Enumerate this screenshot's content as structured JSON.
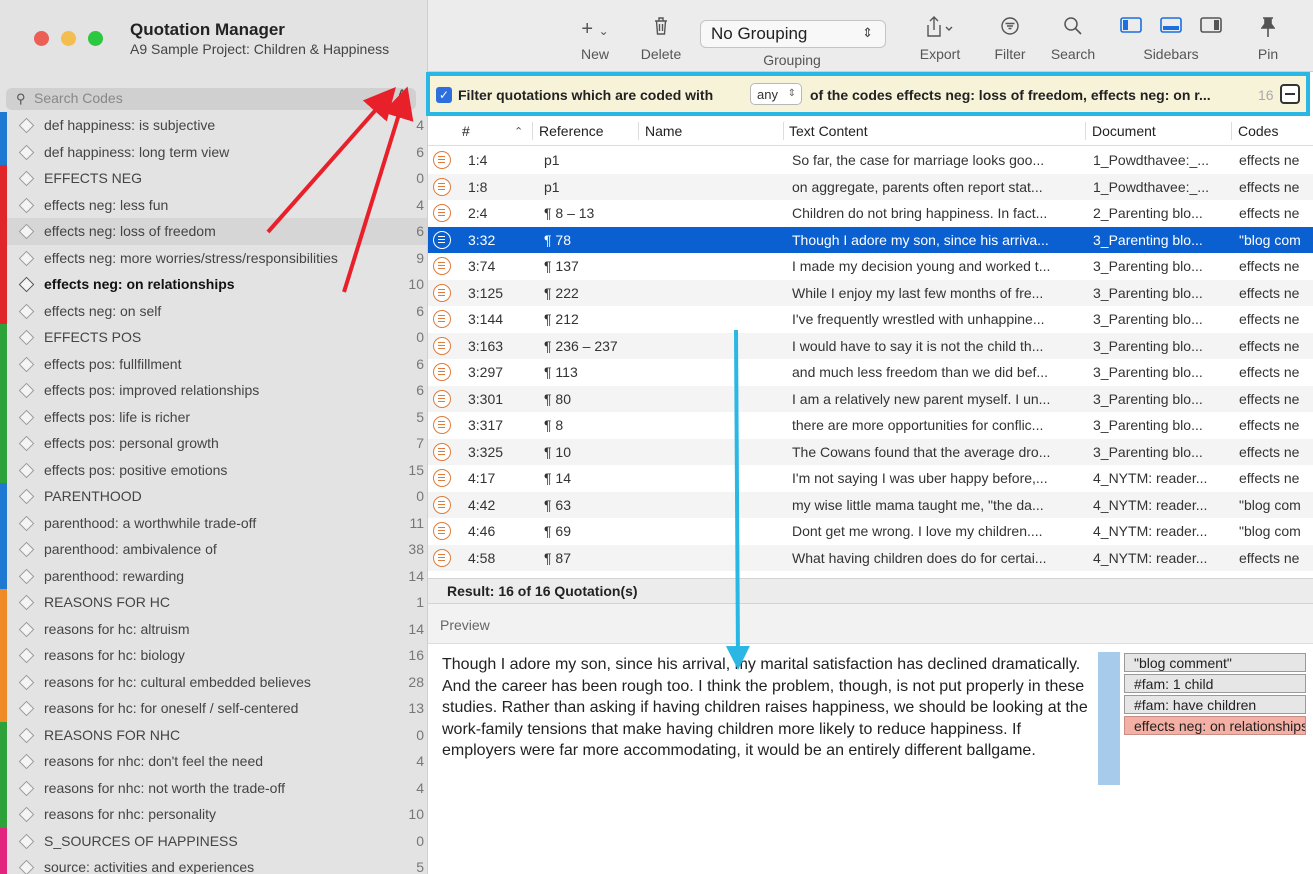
{
  "window": {
    "title": "Quotation Manager",
    "subtitle": "A9 Sample Project: Children & Happiness"
  },
  "colors": {
    "accent": "#0a60d0",
    "traffic_red": "#ec5f57",
    "traffic_yellow": "#f3bd4f",
    "traffic_green": "#2bc840",
    "annotation_red": "#e8202a",
    "annotation_blue": "#2bb7e4"
  },
  "toolbar": {
    "new": {
      "label": "New",
      "icon": "plus-chevron-icon"
    },
    "delete": {
      "label": "Delete",
      "icon": "trash-icon"
    },
    "grouping": {
      "label": "Grouping",
      "value": "No Grouping"
    },
    "export": {
      "label": "Export",
      "icon": "share-chevron-icon"
    },
    "filter": {
      "label": "Filter",
      "icon": "filter-icon"
    },
    "search": {
      "label": "Search",
      "icon": "search-icon"
    },
    "sidebars": {
      "label": "Sidebars"
    },
    "pin": {
      "label": "Pin",
      "icon": "pin-icon"
    }
  },
  "sidebar": {
    "search_placeholder": "Search Codes",
    "codes": [
      {
        "name": "def happiness: is subjective",
        "count": "4",
        "color": "#1f78d1"
      },
      {
        "name": "def happiness: long term view",
        "count": "6",
        "color": "#1f78d1"
      },
      {
        "name": "EFFECTS NEG",
        "count": "0",
        "color": "#e0252b"
      },
      {
        "name": "effects neg: less fun",
        "count": "4",
        "color": "#e0252b"
      },
      {
        "name": "effects neg: loss of freedom",
        "count": "6",
        "color": "#e0252b",
        "selected": true
      },
      {
        "name": "effects neg: more worries/stress/responsibilities",
        "count": "9",
        "color": "#e0252b"
      },
      {
        "name": "effects neg: on relationships",
        "count": "10",
        "color": "#e0252b",
        "bold": true
      },
      {
        "name": "effects neg: on self",
        "count": "6",
        "color": "#e0252b"
      },
      {
        "name": "EFFECTS POS",
        "count": "0",
        "color": "#2da13a"
      },
      {
        "name": "effects pos: fullfillment",
        "count": "6",
        "color": "#2da13a"
      },
      {
        "name": "effects pos: improved relationships",
        "count": "6",
        "color": "#2da13a"
      },
      {
        "name": "effects pos: life is richer",
        "count": "5",
        "color": "#2da13a"
      },
      {
        "name": "effects pos: personal growth",
        "count": "7",
        "color": "#2da13a"
      },
      {
        "name": "effects pos: positive emotions",
        "count": "15",
        "color": "#2da13a"
      },
      {
        "name": "PARENTHOOD",
        "count": "0",
        "color": "#1f78d1"
      },
      {
        "name": "parenthood: a worthwhile trade-off",
        "count": "11",
        "color": "#1f78d1"
      },
      {
        "name": "parenthood: ambivalence of",
        "count": "38",
        "color": "#1f78d1"
      },
      {
        "name": "parenthood: rewarding",
        "count": "14",
        "color": "#1f78d1"
      },
      {
        "name": "REASONS FOR HC",
        "count": "1",
        "color": "#f08a24"
      },
      {
        "name": "reasons for hc: altruism",
        "count": "14",
        "color": "#f08a24"
      },
      {
        "name": "reasons for hc: biology",
        "count": "16",
        "color": "#f08a24"
      },
      {
        "name": "reasons for hc: cultural embedded believes",
        "count": "28",
        "color": "#f08a24"
      },
      {
        "name": "reasons for hc: for oneself / self-centered",
        "count": "13",
        "color": "#f08a24"
      },
      {
        "name": "REASONS FOR NHC",
        "count": "0",
        "color": "#2da13a"
      },
      {
        "name": "reasons for nhc: don't feel the need",
        "count": "4",
        "color": "#2da13a"
      },
      {
        "name": "reasons for nhc: not worth the trade-off",
        "count": "4",
        "color": "#2da13a"
      },
      {
        "name": "reasons for nhc: personality",
        "count": "10",
        "color": "#2da13a"
      },
      {
        "name": "S_SOURCES OF HAPPINESS",
        "count": "0",
        "color": "#e2267f"
      },
      {
        "name": "source: activities and experiences",
        "count": "5",
        "color": "#e2267f"
      }
    ]
  },
  "filter_bar": {
    "text_before": "Filter quotations which are coded with",
    "mode": "any",
    "text_after": "of the codes effects neg: loss of freedom, effects neg: on r...",
    "count": "16"
  },
  "table": {
    "columns": [
      "#",
      "Reference",
      "Name",
      "Text Content",
      "Document",
      "Codes"
    ],
    "rows": [
      {
        "id": "1:4",
        "ref": "p1",
        "name": "",
        "text": "So far, the case for marriage looks goo...",
        "doc": "1_Powdthavee:_...",
        "codes": "effects ne"
      },
      {
        "id": "1:8",
        "ref": "p1",
        "name": "",
        "text": "on aggregate, parents often report stat...",
        "doc": "1_Powdthavee:_...",
        "codes": "effects ne"
      },
      {
        "id": "2:4",
        "ref": "¶ 8 – 13",
        "name": "",
        "text": "Children do not bring happiness. In fact...",
        "doc": "2_Parenting blo...",
        "codes": "effects ne"
      },
      {
        "id": "3:32",
        "ref": "¶ 78",
        "name": "",
        "text": "Though I adore my son, since his arriva...",
        "doc": "3_Parenting blo...",
        "codes": "\"blog com",
        "selected": true
      },
      {
        "id": "3:74",
        "ref": "¶ 137",
        "name": "",
        "text": "I made my decision young and worked t...",
        "doc": "3_Parenting blo...",
        "codes": "effects ne"
      },
      {
        "id": "3:125",
        "ref": "¶ 222",
        "name": "",
        "text": "While I enjoy my last few months of fre...",
        "doc": "3_Parenting blo...",
        "codes": "effects ne"
      },
      {
        "id": "3:144",
        "ref": "¶ 212",
        "name": "",
        "text": "I've frequently wrestled with unhappine...",
        "doc": "3_Parenting blo...",
        "codes": "effects ne"
      },
      {
        "id": "3:163",
        "ref": "¶ 236 – 237",
        "name": "",
        "text": "I would have to say it is not the child th...",
        "doc": "3_Parenting blo...",
        "codes": "effects ne"
      },
      {
        "id": "3:297",
        "ref": "¶ 113",
        "name": "",
        "text": "and much less freedom than we did bef...",
        "doc": "3_Parenting blo...",
        "codes": "effects ne"
      },
      {
        "id": "3:301",
        "ref": "¶ 80",
        "name": "",
        "text": "I am a relatively new parent myself. I un...",
        "doc": "3_Parenting blo...",
        "codes": "effects ne"
      },
      {
        "id": "3:317",
        "ref": "¶ 8",
        "name": "",
        "text": "there are more opportunities for conflic...",
        "doc": "3_Parenting blo...",
        "codes": "effects ne"
      },
      {
        "id": "3:325",
        "ref": "¶ 10",
        "name": "",
        "text": "The Cowans found that the average dro...",
        "doc": "3_Parenting blo...",
        "codes": "effects ne"
      },
      {
        "id": "4:17",
        "ref": "¶ 14",
        "name": "",
        "text": "I'm not saying I was uber happy before,...",
        "doc": "4_NYTM: reader...",
        "codes": "effects ne"
      },
      {
        "id": "4:42",
        "ref": "¶ 63",
        "name": "",
        "text": "my wise little mama taught me, \"the da...",
        "doc": "4_NYTM: reader...",
        "codes": "\"blog com"
      },
      {
        "id": "4:46",
        "ref": "¶ 69",
        "name": "",
        "text": "Dont get me wrong. I love my children....",
        "doc": "4_NYTM: reader...",
        "codes": "\"blog com"
      },
      {
        "id": "4:58",
        "ref": "¶ 87",
        "name": "",
        "text": "What having children does do for certai...",
        "doc": "4_NYTM: reader...",
        "codes": "effects ne"
      }
    ],
    "result": "Result: 16 of 16 Quotation(s)"
  },
  "preview": {
    "header": "Preview",
    "text": "Though I adore my son, since his arrival, my marital satisfaction has declined dramatically. And the career has been rough too. I think the problem, though, is not put properly in these studies. Rather than asking if having children raises happiness, we should be looking at the work-family tensions that make having children more likely to reduce happiness. If employers were far more accommodating, it would be an entirely different ballgame.",
    "tags": [
      {
        "label": "\"blog comment\"",
        "red": false
      },
      {
        "label": "#fam: 1 child",
        "red": false
      },
      {
        "label": "#fam: have children",
        "red": false
      },
      {
        "label": "effects neg: on relationships",
        "red": true
      }
    ]
  }
}
